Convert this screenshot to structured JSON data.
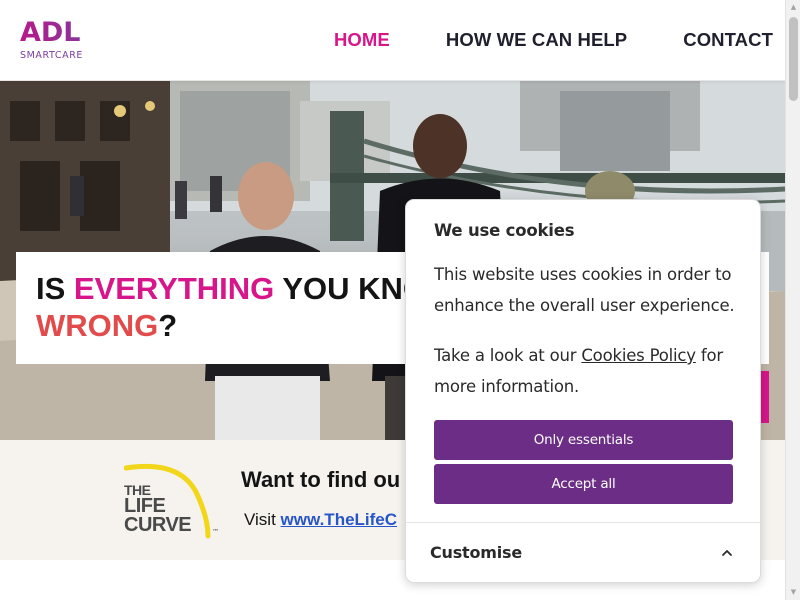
{
  "header": {
    "logo": {
      "brand": "ADL",
      "tagline": "SMARTCARE"
    },
    "nav": [
      {
        "label": "HOME",
        "active": true
      },
      {
        "label": "HOW WE CAN HELP",
        "active": false
      },
      {
        "label": "CONTACT",
        "active": false
      }
    ]
  },
  "hero": {
    "headline_line1_a": "IS ",
    "headline_line1_b": "EVERYTHING",
    "headline_line1_c": " YOU KNO",
    "headline_line2_a": "WRONG",
    "headline_line2_b": "?"
  },
  "lifecurve": {
    "logo_word1": "THE",
    "logo_word2": "LIFE",
    "logo_word3": "CURVE",
    "logo_tm": "™",
    "title": "Want to find ou",
    "visit_label": "Visit ",
    "link_text": "www.TheLifeC"
  },
  "cookie_dialog": {
    "title": "We use cookies",
    "body": "This website uses cookies in order to enhance the overall user experience.",
    "policy_prefix": "Take a look at our ",
    "policy_link": "Cookies Policy",
    "policy_suffix": " for more information.",
    "button_essentials": "Only essentials",
    "button_accept": "Accept all",
    "customise_label": "Customise"
  },
  "colors": {
    "brand_pink": "#d6168a",
    "brand_purple": "#6b2d85",
    "headline_red": "#e24b4b",
    "link_blue": "#2756c9",
    "lifecurve_yellow": "#f2d61a"
  },
  "icons": {
    "customise_toggle": "chevron-up-icon",
    "scroll_up": "scroll-up-arrow-icon",
    "scroll_down": "scroll-down-arrow-icon"
  }
}
